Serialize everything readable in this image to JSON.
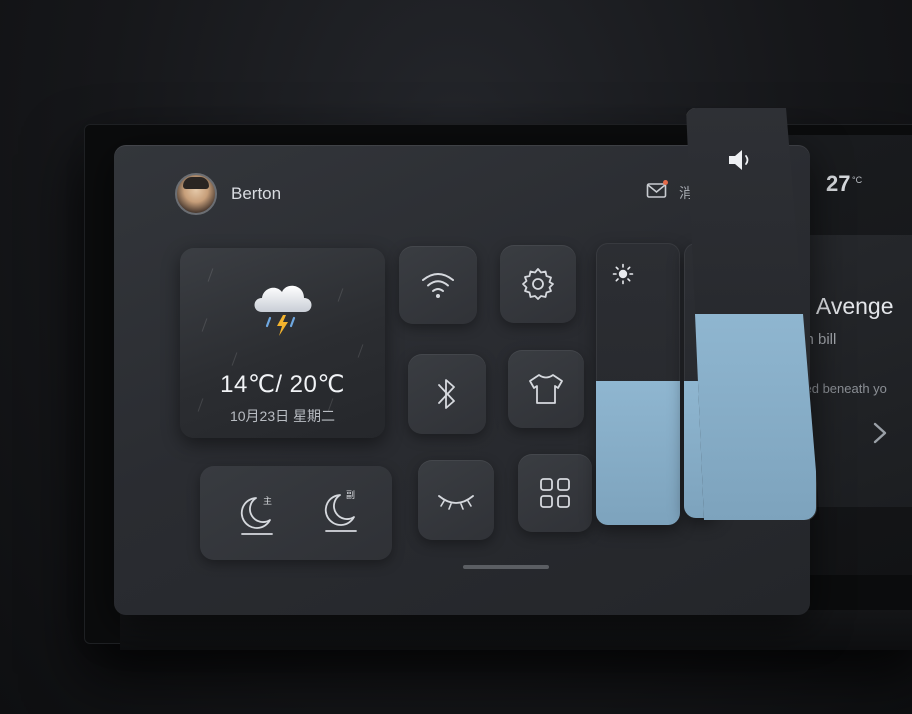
{
  "header": {
    "username": "Berton",
    "message_char": "消"
  },
  "weather": {
    "temperature": "14℃/ 20℃",
    "date": "10月23日 星期二",
    "icon": "cloud-thunder-rain-icon"
  },
  "controls": {
    "wifi_icon": "wifi-icon",
    "settings_icon": "gear-icon",
    "bluetooth_icon": "bluetooth-icon",
    "clothing_icon": "tshirt-icon",
    "sleep_icon": "closed-eye-icon",
    "apps_icon": "grid-icon"
  },
  "sleep_mode": {
    "driver_label": "主",
    "passenger_label": "副"
  },
  "sliders": {
    "brightness_level": 0.51,
    "volume_level": 0.5
  },
  "background_screen": {
    "temperature": "27",
    "temperature_unit": "°C",
    "music_title": "e Avenge",
    "music_artist": "tin bill",
    "lyric": "ked beneath yo"
  },
  "colors": {
    "accent_fill": "#8fb6d0",
    "notification_dot": "#e46a4a"
  }
}
